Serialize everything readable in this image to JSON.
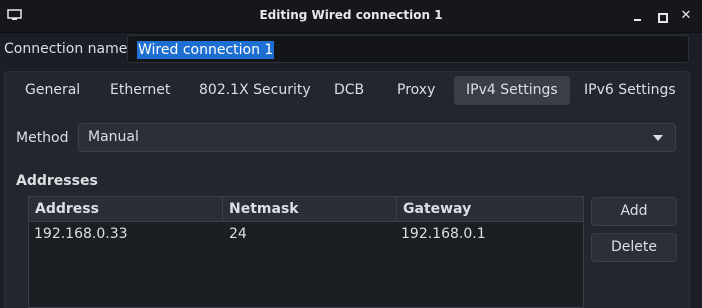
{
  "window": {
    "title": "Editing Wired connection 1",
    "controls": {
      "minimize": "minimize-icon",
      "maximize": "maximize-icon",
      "close": "close-icon"
    }
  },
  "connection": {
    "label": "Connection name",
    "value": "Wired connection 1"
  },
  "tabs": [
    {
      "label": "General"
    },
    {
      "label": "Ethernet"
    },
    {
      "label": "802.1X Security"
    },
    {
      "label": "DCB"
    },
    {
      "label": "Proxy"
    },
    {
      "label": "IPv4 Settings",
      "active": true
    },
    {
      "label": "IPv6 Settings"
    }
  ],
  "ipv4": {
    "method_label": "Method",
    "method_value": "Manual",
    "addresses_heading": "Addresses",
    "columns": [
      "Address",
      "Netmask",
      "Gateway"
    ],
    "rows": [
      {
        "address": "192.168.0.33",
        "netmask": "24",
        "gateway": "192.168.0.1"
      }
    ],
    "add_label": "Add",
    "delete_label": "Delete"
  },
  "colors": {
    "background": "#1b1e24",
    "panel": "#23262d",
    "selection": "#1f6fd2",
    "text": "#dcdfe4"
  }
}
